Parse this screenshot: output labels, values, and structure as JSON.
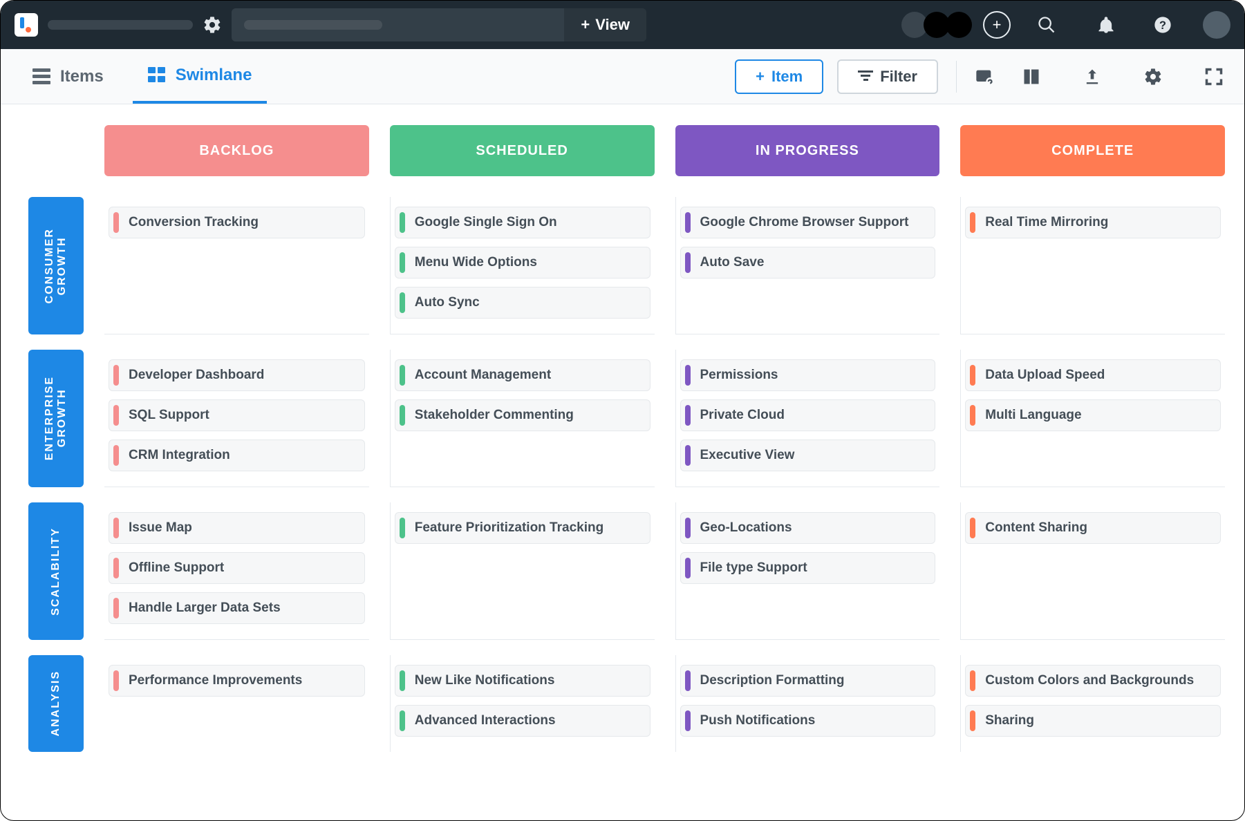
{
  "topbar": {
    "view_btn": "View"
  },
  "toolbar": {
    "tabs": [
      {
        "id": "items",
        "label": "Items",
        "active": false
      },
      {
        "id": "swimlane",
        "label": "Swimlane",
        "active": true
      }
    ],
    "item_btn": "Item",
    "filter_btn": "Filter"
  },
  "columns": [
    {
      "id": "backlog",
      "label": "BACKLOG",
      "color": "#f58e8e"
    },
    {
      "id": "scheduled",
      "label": "SCHEDULED",
      "color": "#4dc28a"
    },
    {
      "id": "inprogress",
      "label": "IN PROGRESS",
      "color": "#7e57c2"
    },
    {
      "id": "complete",
      "label": "COMPLETE",
      "color": "#ff7b52"
    }
  ],
  "lanes": [
    {
      "id": "consumer-growth",
      "label": "CONSUMER\nGROWTH",
      "cells": {
        "backlog": [
          "Conversion Tracking"
        ],
        "scheduled": [
          "Google Single Sign On",
          "Menu Wide Options",
          "Auto Sync"
        ],
        "inprogress": [
          "Google Chrome Browser Support",
          "Auto Save"
        ],
        "complete": [
          "Real Time Mirroring"
        ]
      }
    },
    {
      "id": "enterprise-growth",
      "label": "ENTERPRISE\nGROWTH",
      "cells": {
        "backlog": [
          "Developer Dashboard",
          "SQL Support",
          "CRM Integration"
        ],
        "scheduled": [
          "Account Management",
          "Stakeholder Commenting"
        ],
        "inprogress": [
          "Permissions",
          "Private Cloud",
          "Executive View"
        ],
        "complete": [
          "Data Upload Speed",
          "Multi Language"
        ]
      }
    },
    {
      "id": "scalability",
      "label": "SCALABILITY",
      "cells": {
        "backlog": [
          "Issue Map",
          "Offline Support",
          "Handle Larger Data Sets"
        ],
        "scheduled": [
          "Feature Prioritization Tracking"
        ],
        "inprogress": [
          "Geo-Locations",
          "File type Support"
        ],
        "complete": [
          "Content Sharing"
        ]
      }
    },
    {
      "id": "analysis",
      "label": "ANALYSIS",
      "cells": {
        "backlog": [
          "Performance Improvements"
        ],
        "scheduled": [
          "New Like Notifications",
          "Advanced Interactions"
        ],
        "inprogress": [
          "Description Formatting",
          "Push Notifications"
        ],
        "complete": [
          "Custom Colors and Backgrounds",
          "Sharing"
        ]
      }
    }
  ]
}
